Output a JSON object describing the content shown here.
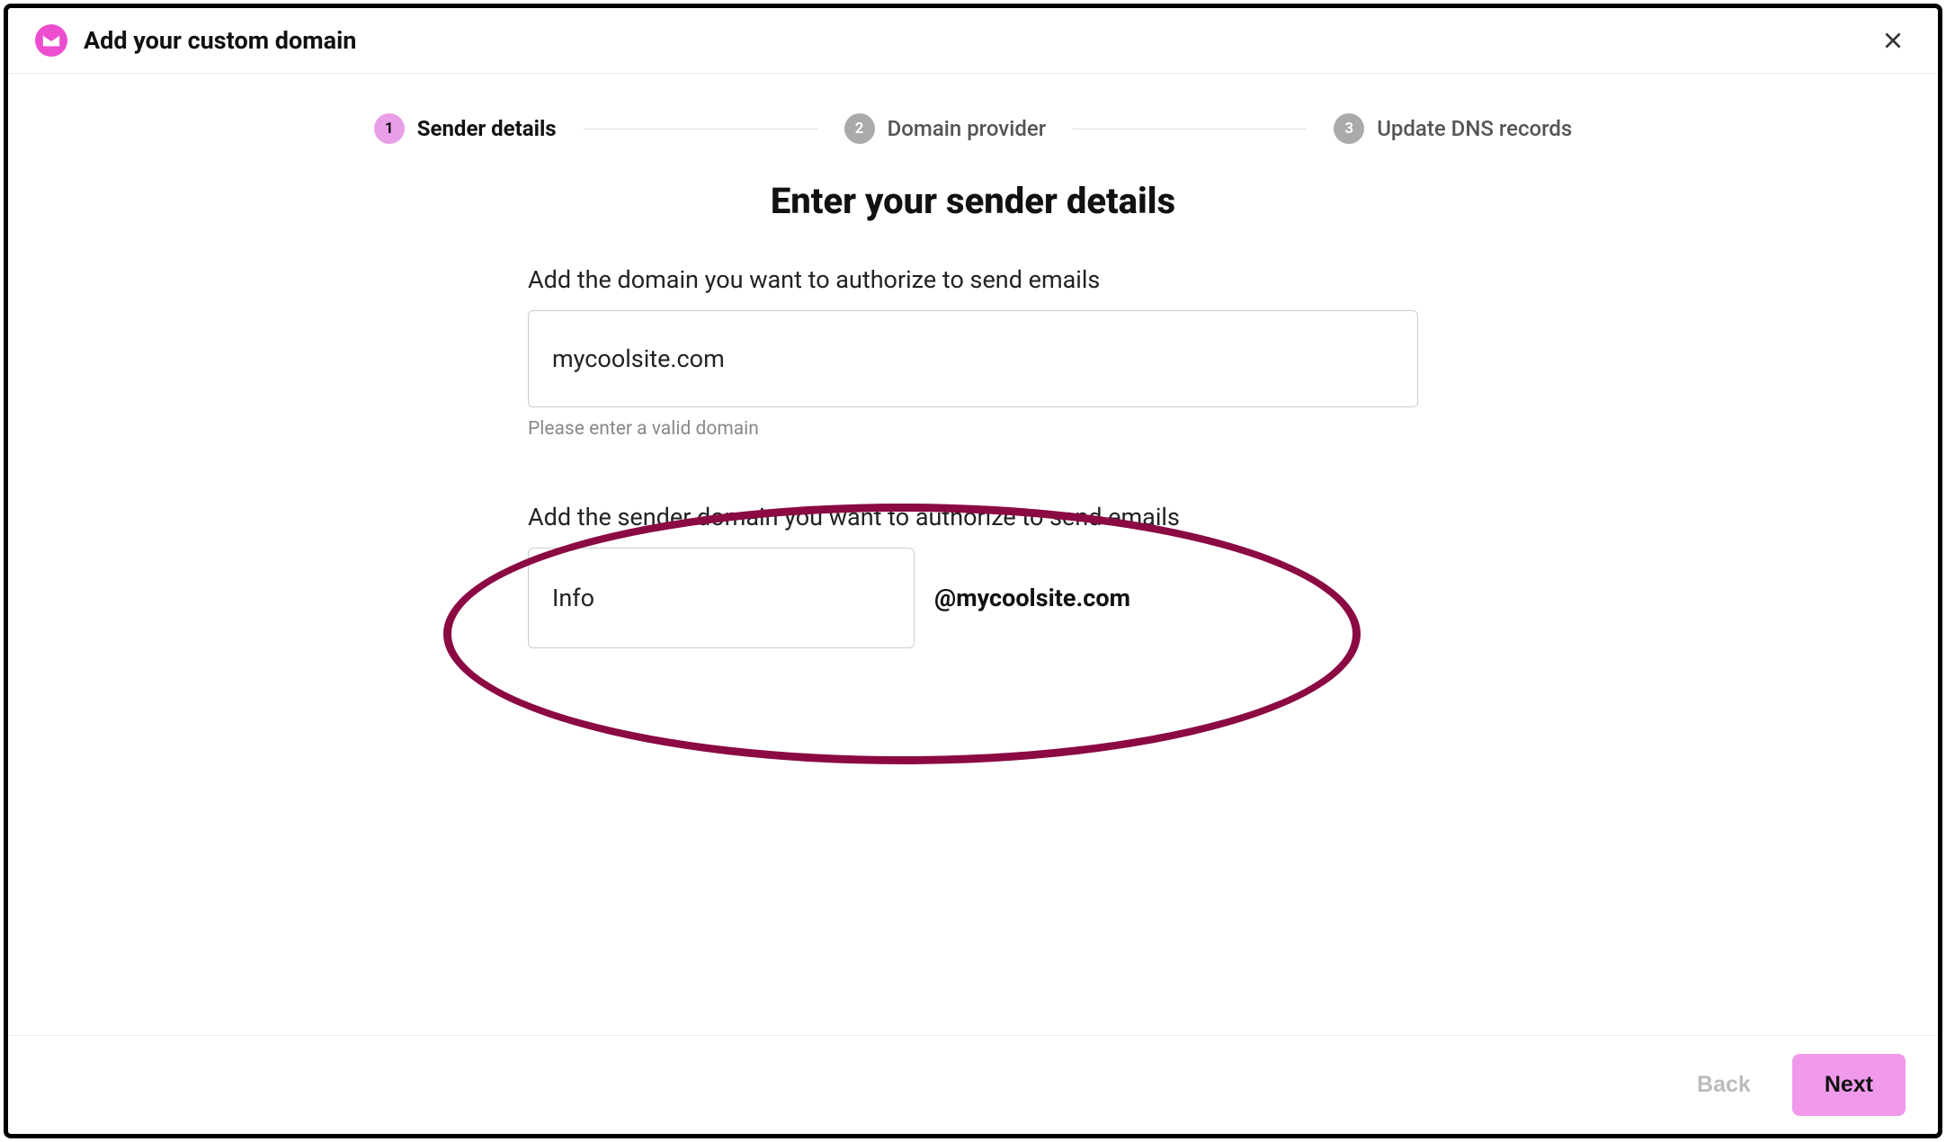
{
  "header": {
    "title": "Add your custom domain"
  },
  "stepper": {
    "steps": [
      {
        "number": "1",
        "label": "Sender details",
        "active": true
      },
      {
        "number": "2",
        "label": "Domain provider",
        "active": false
      },
      {
        "number": "3",
        "label": "Update DNS records",
        "active": false
      }
    ]
  },
  "main": {
    "title": "Enter your sender details",
    "domain_label": "Add the domain you want to authorize to send emails",
    "domain_value": "mycoolsite.com",
    "domain_help": "Please enter a valid domain",
    "sender_label": "Add the sender domain you want to authorize to send emails",
    "sender_value": "Info",
    "sender_suffix": "@mycoolsite.com"
  },
  "footer": {
    "back_label": "Back",
    "next_label": "Next"
  }
}
